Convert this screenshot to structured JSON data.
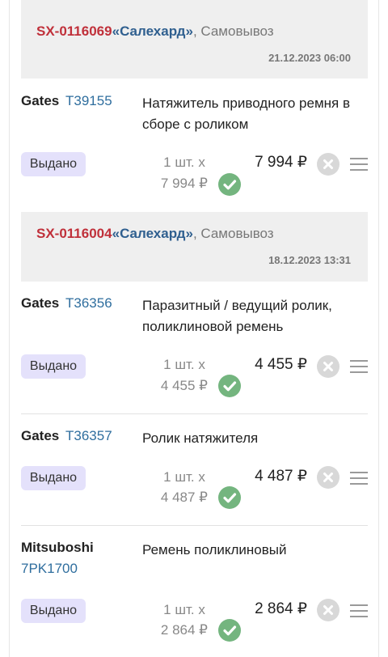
{
  "orders": [
    {
      "number": "SX-0116069",
      "quote_open": "«",
      "city": "Салехард",
      "quote_close": "»",
      "shipping": ", Самовывоз",
      "date": "21.12.2023 06:00",
      "items": [
        {
          "brand": "Gates",
          "article": "T39155",
          "name": "Натяжитель приводного ремня в сборе с роликом",
          "status": "Выдано",
          "quantity": "1 шт. х",
          "unit_price": "7 994 ₽",
          "price": "7 994 ₽"
        }
      ]
    },
    {
      "number": "SX-0116004",
      "quote_open": "«",
      "city": "Салехард",
      "quote_close": "»",
      "shipping": ", Самовывоз",
      "date": "18.12.2023 13:31",
      "items": [
        {
          "brand": "Gates",
          "article": "T36356",
          "name": "Паразитный / ведущий ролик, поликлиновой ремень",
          "status": "Выдано",
          "quantity": "1 шт. х",
          "unit_price": "4 455 ₽",
          "price": "4 455 ₽"
        },
        {
          "brand": "Gates",
          "article": "T36357",
          "name": "Ролик натяжителя",
          "status": "Выдано",
          "quantity": "1 шт. х",
          "unit_price": "4 487 ₽",
          "price": "4 487 ₽"
        },
        {
          "brand": "Mitsuboshi",
          "article": "7PK1700",
          "name": "Ремень поликлиновый",
          "status": "Выдано",
          "quantity": "1 шт. х",
          "unit_price": "2 864 ₽",
          "price": "2 864 ₽"
        }
      ]
    }
  ],
  "icons": {
    "status_ok": "check-circle-icon",
    "remove": "close-circle-icon",
    "menu": "hamburger-menu-icon"
  },
  "colors": {
    "order_number": "#c0303a",
    "city": "#2f5f8f",
    "article_link": "#2f6e9e",
    "badge_bg": "#e4e1fb",
    "check_green": "#74b57f",
    "header_bg": "#efefef"
  }
}
